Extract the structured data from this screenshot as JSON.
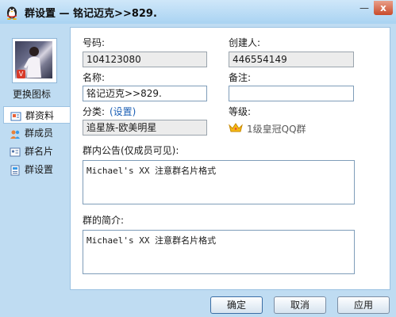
{
  "window": {
    "title": "群设置 — 铭记迈克>>829.",
    "minimize_glyph": "—",
    "close_glyph": "x"
  },
  "sidebar": {
    "change_icon_label": "更换图标",
    "items": [
      {
        "label": "群资料",
        "icon": "group-info-icon",
        "active": true
      },
      {
        "label": "群成员",
        "icon": "group-members-icon",
        "active": false
      },
      {
        "label": "群名片",
        "icon": "group-card-icon",
        "active": false
      },
      {
        "label": "群设置",
        "icon": "group-settings-icon",
        "active": false
      }
    ]
  },
  "form": {
    "number_label": "号码:",
    "number_value": "104123080",
    "creator_label": "创建人:",
    "creator_value": "446554149",
    "name_label": "名称:",
    "name_value": "铭记迈克>>829.",
    "remark_label": "备注:",
    "remark_value": "",
    "category_label": "分类:",
    "category_link": "(设置)",
    "category_value": "追星族-欧美明星",
    "level_label": "等级:",
    "level_value": "1级皇冠QQ群",
    "announcement_label": "群内公告(仅成员可见):",
    "announcement_value": "Michael's XX 注意群名片格式",
    "intro_label": "群的简介:",
    "intro_value": "Michael's XX 注意群名片格式"
  },
  "buttons": {
    "ok": "确定",
    "cancel": "取消",
    "apply": "应用"
  },
  "colors": {
    "background": "#bfdcf2",
    "panel": "#ffffff",
    "link": "#1b5fb5",
    "close_button": "#c94b2b"
  }
}
